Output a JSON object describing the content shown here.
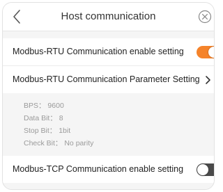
{
  "header": {
    "title": "Host communication",
    "back_icon": "chevron-left-icon",
    "close_icon": "close-circle-icon"
  },
  "rtu_enable": {
    "label": "Modbus-RTU Communication enable setting",
    "enabled": true,
    "on_color": "#f5832a"
  },
  "rtu_params": {
    "label": "Modbus-RTU Communication Parameter Setting",
    "icon": "chevron-right-icon",
    "items": [
      {
        "name": "BPS",
        "separator": "：",
        "value": "9600"
      },
      {
        "name": "Data Bit",
        "separator": "：",
        "value": "8"
      },
      {
        "name": "Stop Bit",
        "separator": "：",
        "value": "1bit"
      },
      {
        "name": "Check Bit",
        "separator": "：",
        "value": "No parity"
      }
    ],
    "lines": [
      "BPS： 9600",
      "Data Bit： 8",
      "Stop Bit： 1bit",
      "Check Bit： No parity"
    ]
  },
  "tcp_enable": {
    "label": "Modbus-TCP Communication enable setting",
    "enabled": false,
    "off_color": "#4a4a4a"
  }
}
